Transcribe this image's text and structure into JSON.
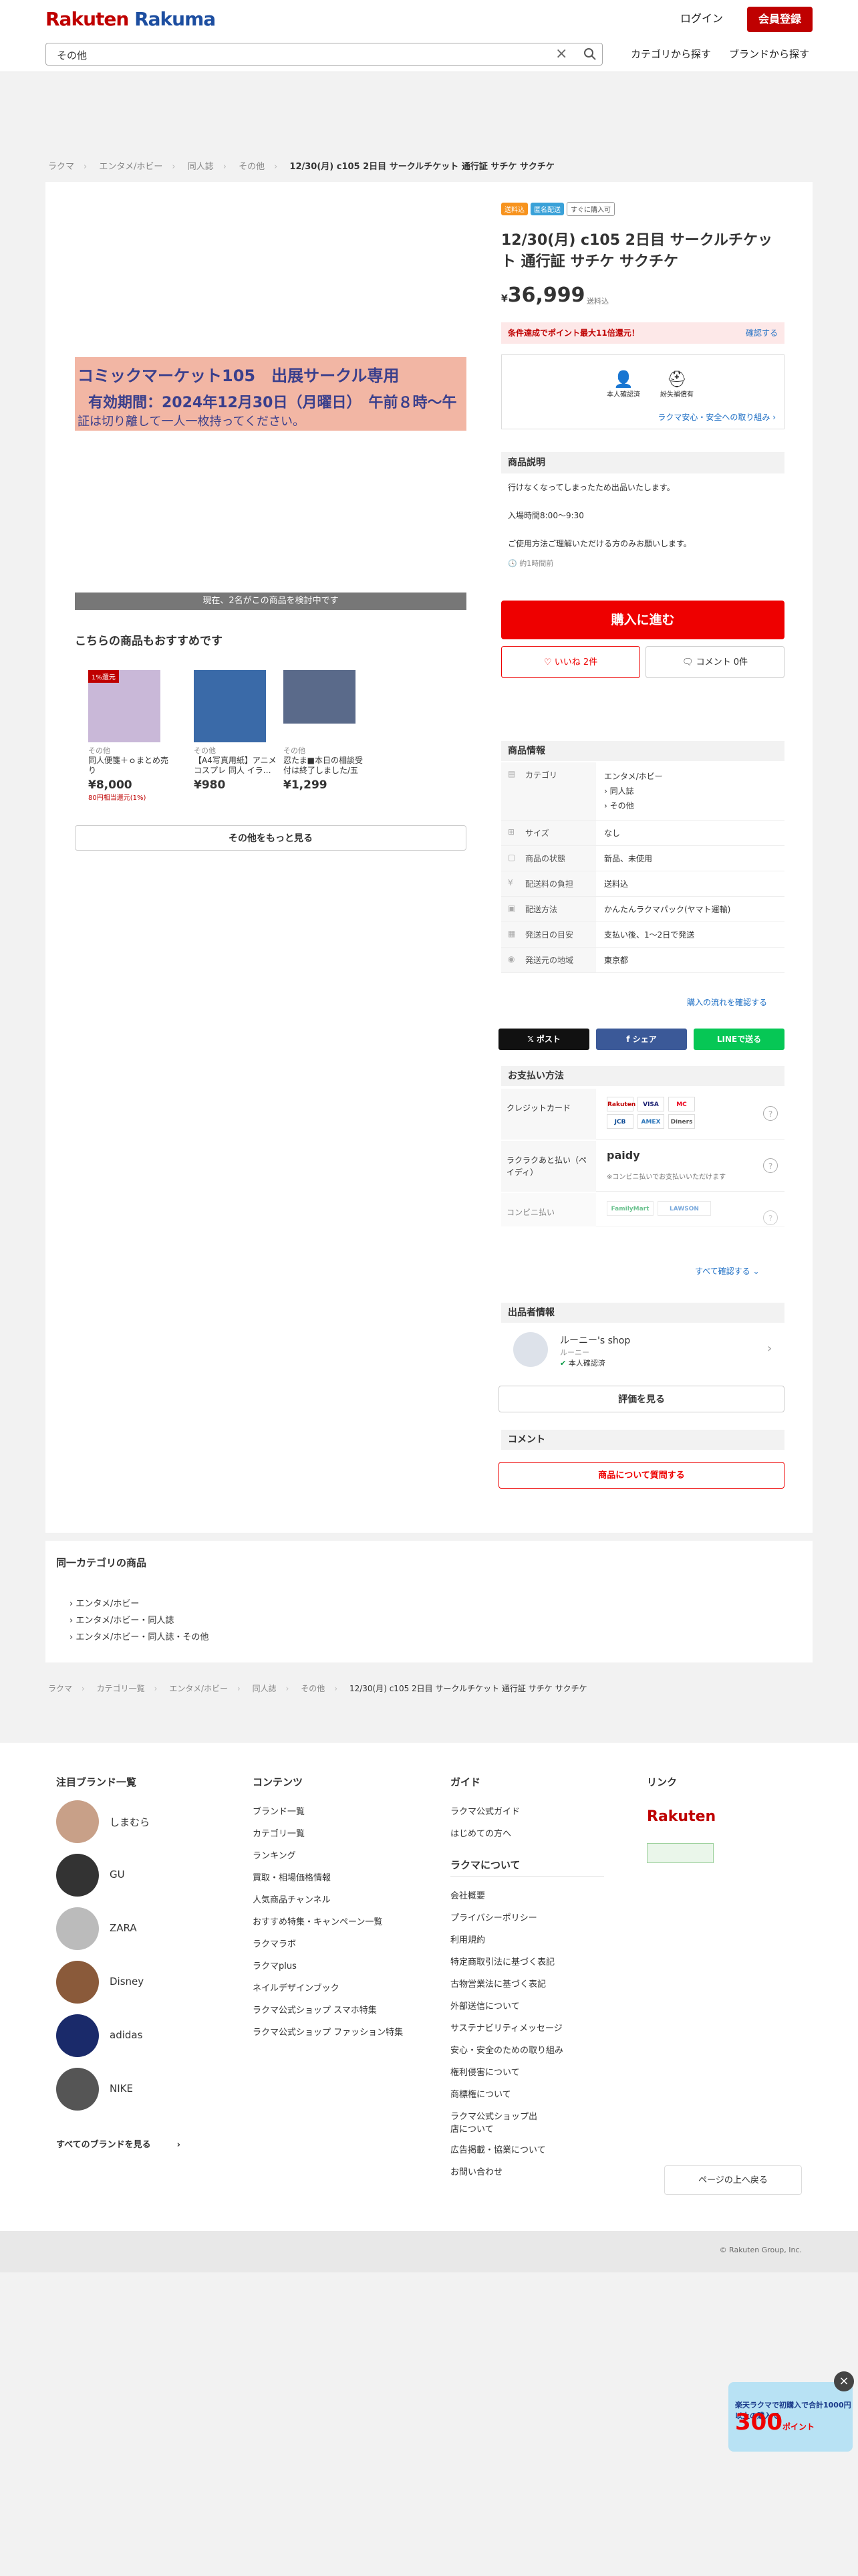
{
  "header": {
    "logo_a": "Rakuten",
    "logo_b": " Rakuma",
    "login": "ログイン",
    "register": "会員登録",
    "search_value": "その他",
    "nav_category": "カテゴリから探す",
    "nav_brand": "ブランドから探す"
  },
  "breadcrumb": [
    "ラクマ",
    "エンタメ/ホビー",
    "同人誌",
    "その他",
    "12/30(月) c105 2日目 サークルチケット 通行証 サチケ サクチケ"
  ],
  "gallery": {
    "ticket_line1": "コミックマーケット105　出展サークル専用",
    "ticket_line2": "有効期間：2024年12月30日（月曜日）　午前８時〜午",
    "ticket_line3": "証は切り離して一人一枚持ってください。",
    "watching": "現在、2名がこの商品を検討中です"
  },
  "recommend": {
    "title": "こちらの商品もおすすめです",
    "items": [
      {
        "badge": "1%還元",
        "cat": "その他",
        "name": "同人便箋＋ｏまとめ売り",
        "price": "¥8,000",
        "pts": "80円相当還元(1%)"
      },
      {
        "badge": "",
        "cat": "その他",
        "name": "【A4写真用紙】アニメ コスプレ 同人 イラ…",
        "price": "¥980",
        "pts": ""
      },
      {
        "badge": "",
        "cat": "その他",
        "name": "忍たま■本日の相談受付は終了しました/五年…",
        "price": "¥1,299",
        "pts": ""
      }
    ],
    "more": "その他をもっと見る"
  },
  "product": {
    "tags": [
      "送料込",
      "匿名配送",
      "すぐに購入可"
    ],
    "tag_colors": [
      "#f7931e",
      "#3aa1d8",
      "#ffffff"
    ],
    "title": "12/30(月) c105 2日目 サークルチケット 通行証 サチケ サクチケ",
    "yen": "¥",
    "price": "36,999",
    "shipping": "送料込",
    "campaign": "条件達成でポイント最大11倍還元！",
    "campaign_link": "確認する",
    "safe_a": "本人確認済",
    "safe_b": "紛失補償有",
    "safe_link": "ラクマ安心・安全への取り組み",
    "desc_title": "商品説明",
    "desc": [
      "行けなくなってしまったため出品いたします。",
      "入場時間8:00〜9:30",
      "ご使用方法ご理解いただける方のみお願いします。"
    ],
    "desc_time": "約1時間前",
    "buy": "購入に進む",
    "like": "いいね 2件",
    "comment": "コメント 0件"
  },
  "info": {
    "title": "商品情報",
    "rows": [
      {
        "k": "カテゴリ",
        "v": "エンタメ/ホビー\n› 同人誌\n› その他"
      },
      {
        "k": "サイズ",
        "v": "なし"
      },
      {
        "k": "商品の状態",
        "v": "新品、未使用"
      },
      {
        "k": "配送料の負担",
        "v": "送料込"
      },
      {
        "k": "配送方法",
        "v": "かんたんラクマパック(ヤマト運輸)"
      },
      {
        "k": "発送日の目安",
        "v": "支払い後、1〜2日で発送"
      },
      {
        "k": "発送元の地域",
        "v": "東京都"
      }
    ],
    "flow_link": "購入の流れを確認する"
  },
  "share": {
    "x": "𝕏 ポスト",
    "fb": "f シェア",
    "line": "LINEで送る"
  },
  "payment": {
    "title": "お支払い方法",
    "rows": [
      {
        "k": "クレジットカード",
        "logos": [
          "Rakuten",
          "VISA",
          "MC",
          "JCB",
          "AMEX",
          "Diners"
        ]
      },
      {
        "k": "ラクラクあと払い（ペイディ）",
        "logos": [
          "paidy"
        ],
        "note": "※コンビニ払いでお支払いいただけます"
      },
      {
        "k": "コンビニ払い",
        "logos": [
          "FamilyMart",
          "LAWSON"
        ]
      }
    ],
    "see_all": "すべて確認する"
  },
  "seller": {
    "title": "出品者情報",
    "name": "ルーニー's shop",
    "sub": "ルーニー",
    "verify": "本人確認済",
    "review": "評価を見る"
  },
  "comments": {
    "title": "コメント",
    "ask": "商品について質問する"
  },
  "samecat": {
    "title": "同一カテゴリの商品",
    "items": [
      "エンタメ/ホビー",
      "エンタメ/ホビー・同人誌",
      "エンタメ/ホビー・同人誌・その他"
    ]
  },
  "breadcrumb2": [
    "ラクマ",
    "カテゴリ一覧",
    "エンタメ/ホビー",
    "同人誌",
    "その他",
    "12/30(月) c105 2日目 サークルチケット 通行証 サチケ サクチケ"
  ],
  "footer": {
    "brands_title": "注目ブランド一覧",
    "brands": [
      "しまむら",
      "GU",
      "ZARA",
      "Disney",
      "adidas",
      "NIKE"
    ],
    "all_brands": "すべてのブランドを見る",
    "contents_title": "コンテンツ",
    "contents": [
      "ブランド一覧",
      "カテゴリ一覧",
      "ランキング",
      "買取・相場価格情報",
      "人気商品チャンネル",
      "おすすめ特集・キャンペーン一覧",
      "ラクマラボ",
      "ラクマplus",
      "ネイルデザインブック",
      "ラクマ公式ショップ スマホ特集",
      "ラクマ公式ショップ ファッション特集"
    ],
    "guide_title": "ガイド",
    "guide": [
      "ラクマ公式ガイド",
      "はじめての方へ"
    ],
    "about_title": "ラクマについて",
    "about": [
      "会社概要",
      "プライバシーポリシー",
      "利用規約",
      "特定商取引法に基づく表記",
      "古物営業法に基づく表記",
      "外部送信について",
      "サステナビリティメッセージ",
      "安心・安全のための取り組み",
      "権利侵害について",
      "商標権について",
      "ラクマ公式ショップ出店について",
      "広告掲載・協業について",
      "お問い合わせ"
    ],
    "link_title": "リンク",
    "link_rakuten": "Rakuten",
    "top": "ページの上へ戻る",
    "copyright": "© Rakuten Group, Inc."
  },
  "banner": {
    "line1": "楽天ラクマで初購入で合計1000円以上の購入で",
    "line2": "300",
    "line3": "ポイント"
  }
}
